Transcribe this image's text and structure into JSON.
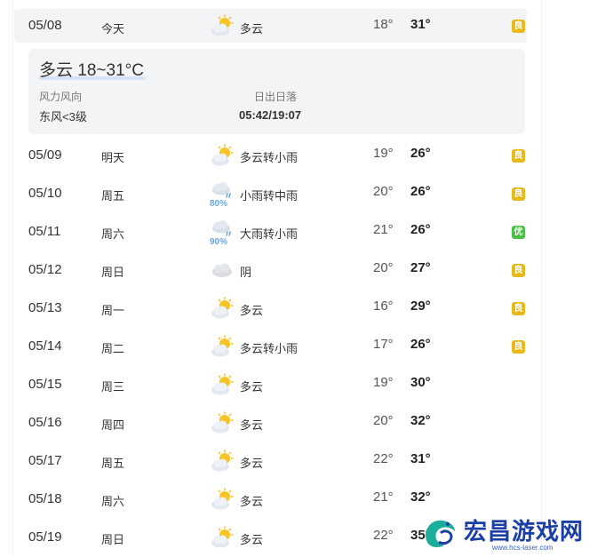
{
  "today_row": {
    "date": "05/08",
    "weekday": "今天",
    "icon": "partly-cloudy-icon",
    "condition": "多云",
    "low": "18°",
    "high": "31°",
    "aqi": "良",
    "aqi_color": "#e7b91b"
  },
  "detail": {
    "title": "多云 18~31°C",
    "wind_label": "风力风向",
    "wind_value": "东风<3级",
    "sun_label": "日出日落",
    "sun_value": "05:42/19:07"
  },
  "rows": [
    {
      "date": "05/09",
      "weekday": "明天",
      "icon": "partly-cloudy-icon",
      "condition": "多云转小雨",
      "low": "19°",
      "high": "26°",
      "aqi": "良",
      "aqi_color": "#e7b91b",
      "precip": ""
    },
    {
      "date": "05/10",
      "weekday": "周五",
      "icon": "rain-icon",
      "condition": "小雨转中雨",
      "low": "20°",
      "high": "26°",
      "aqi": "良",
      "aqi_color": "#e7b91b",
      "precip": "80%"
    },
    {
      "date": "05/11",
      "weekday": "周六",
      "icon": "rain-icon",
      "condition": "大雨转小雨",
      "low": "21°",
      "high": "26°",
      "aqi": "优",
      "aqi_color": "#4cbf45",
      "precip": "90%"
    },
    {
      "date": "05/12",
      "weekday": "周日",
      "icon": "cloudy-icon",
      "condition": "阴",
      "low": "20°",
      "high": "27°",
      "aqi": "良",
      "aqi_color": "#e7b91b",
      "precip": ""
    },
    {
      "date": "05/13",
      "weekday": "周一",
      "icon": "partly-cloudy-icon",
      "condition": "多云",
      "low": "16°",
      "high": "29°",
      "aqi": "良",
      "aqi_color": "#e7b91b",
      "precip": ""
    },
    {
      "date": "05/14",
      "weekday": "周二",
      "icon": "partly-cloudy-icon",
      "condition": "多云转小雨",
      "low": "17°",
      "high": "26°",
      "aqi": "良",
      "aqi_color": "#e7b91b",
      "precip": ""
    },
    {
      "date": "05/15",
      "weekday": "周三",
      "icon": "partly-cloudy-icon",
      "condition": "多云",
      "low": "19°",
      "high": "30°",
      "aqi": "",
      "aqi_color": "",
      "precip": ""
    },
    {
      "date": "05/16",
      "weekday": "周四",
      "icon": "partly-cloudy-icon",
      "condition": "多云",
      "low": "20°",
      "high": "32°",
      "aqi": "",
      "aqi_color": "",
      "precip": ""
    },
    {
      "date": "05/17",
      "weekday": "周五",
      "icon": "partly-cloudy-icon",
      "condition": "多云",
      "low": "22°",
      "high": "31°",
      "aqi": "",
      "aqi_color": "",
      "precip": ""
    },
    {
      "date": "05/18",
      "weekday": "周六",
      "icon": "partly-cloudy-icon",
      "condition": "多云",
      "low": "21°",
      "high": "32°",
      "aqi": "",
      "aqi_color": "",
      "precip": ""
    },
    {
      "date": "05/19",
      "weekday": "周日",
      "icon": "partly-cloudy-icon",
      "condition": "多云",
      "low": "22°",
      "high": "35°",
      "aqi": "",
      "aqi_color": "",
      "precip": ""
    }
  ],
  "watermark": {
    "text": "宏昌游戏网",
    "url": "www.hcs-laser.com",
    "icon": "dragon-logo-icon"
  }
}
